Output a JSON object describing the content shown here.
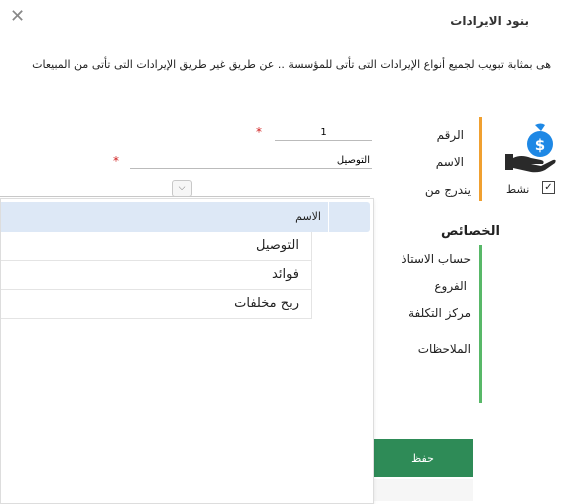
{
  "header": {
    "title": "بنود الايرادات",
    "close_icon": "close-icon",
    "description": "هى بمثابة تبويب لجميع أنواع الإيرادات  التى تأتى  للمؤسسة .. عن طريق  غير طريق الإيرادات التى تأتى من المبيعات"
  },
  "colors": {
    "orange": "#f0a030",
    "green": "#58b868",
    "save": "#2e8b57",
    "dropdown_header": "#dde8f6"
  },
  "form": {
    "number_label": "الرقم",
    "number_value": "1",
    "name_label": "الاسم",
    "name_value": "التوصيل",
    "parent_label": "يندرج من",
    "active_label": "نشط",
    "active_checked": true,
    "required_mark": "*",
    "icon": "money-bag-hand-icon"
  },
  "properties": {
    "heading": "الخصائص",
    "account_label": "حساب الاستاذ",
    "branches_label": "الفروع",
    "cost_center_label": "مركز التكلفة",
    "notes_label": "الملاحظات"
  },
  "dropdown": {
    "column_header": "الاسم",
    "chevron_icon": "chevron-down-icon",
    "options": [
      "التوصيل",
      "فوائد",
      "ربح مخلفات"
    ]
  },
  "actions": {
    "save_label": "حفظ"
  }
}
